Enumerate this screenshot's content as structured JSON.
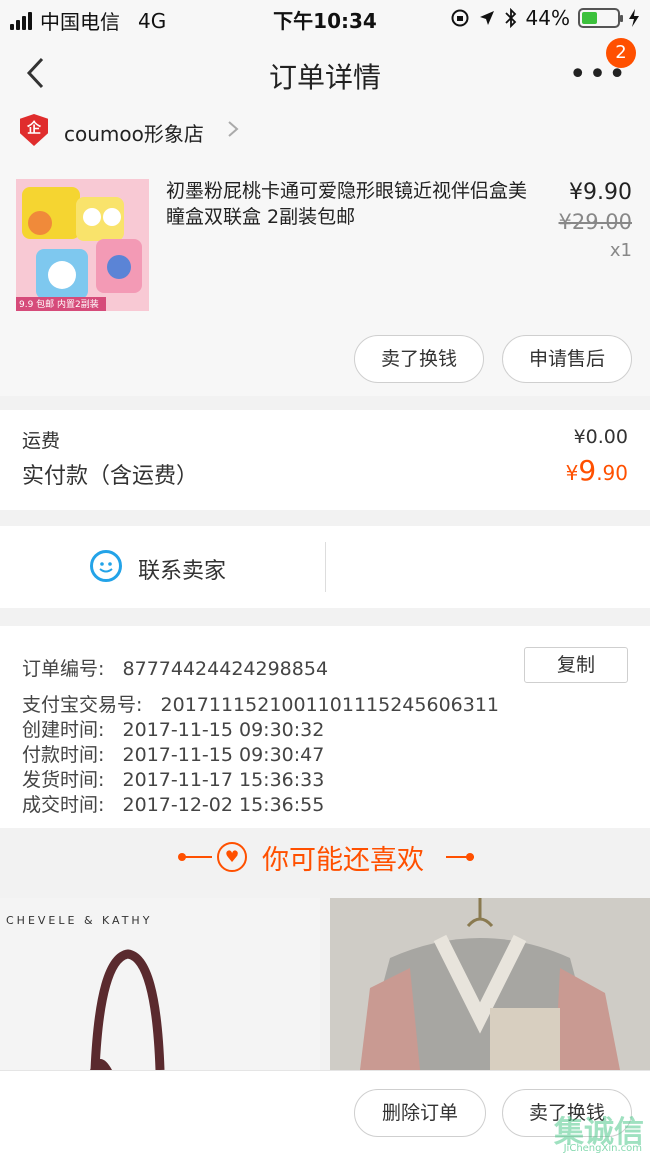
{
  "status_bar": {
    "carrier": "中国电信",
    "network": "4G",
    "time": "下午10:34",
    "battery_percent": "44%",
    "battery_level": 0.44
  },
  "nav": {
    "title": "订单详情",
    "badge_count": "2"
  },
  "shop": {
    "name": "coumoo形象店",
    "icon_text": "企"
  },
  "product": {
    "title": "初墨粉屁桃卡通可爱隐形眼镜近视伴侣盒美瞳盒双联盒 2副装包邮",
    "price": "¥9.90",
    "original_price": "¥29.00",
    "quantity": "x1",
    "thumb_caption": "9.9 包邮 内置2副装"
  },
  "product_actions": {
    "resell": "卖了换钱",
    "after_sale": "申请售后"
  },
  "fee": {
    "shipping_label": "运费",
    "shipping_value": "¥0.00",
    "paid_label": "实付款（含运费）",
    "paid_currency": "¥",
    "paid_int": "9",
    "paid_dec": ".90"
  },
  "contact": {
    "label": "联系卖家"
  },
  "order_info": {
    "order_no_label": "订单编号:",
    "order_no": "87774424424298854",
    "copy_label": "复制",
    "alipay_label": "支付宝交易号:",
    "alipay_no": "2017111521001101115245606311",
    "created_label": "创建时间:",
    "created": "2017-11-15 09:30:32",
    "paid_label": "付款时间:",
    "paid": "2017-11-15 09:30:47",
    "shipped_label": "发货时间:",
    "shipped": "2017-11-17 15:36:33",
    "completed_label": "成交时间:",
    "completed": "2017-12-02 15:36:55"
  },
  "recommend": {
    "title": "你可能还喜欢",
    "brand_left": "CHEVELE & KATHY"
  },
  "bottom_actions": {
    "delete": "删除订单",
    "resell": "卖了换钱"
  },
  "watermark": {
    "main": "集诚信",
    "sub": "JiChengXin.com"
  },
  "colors": {
    "accent": "#ff5000",
    "chat": "#23a3e8",
    "shop_icon": "#e02d2d"
  }
}
